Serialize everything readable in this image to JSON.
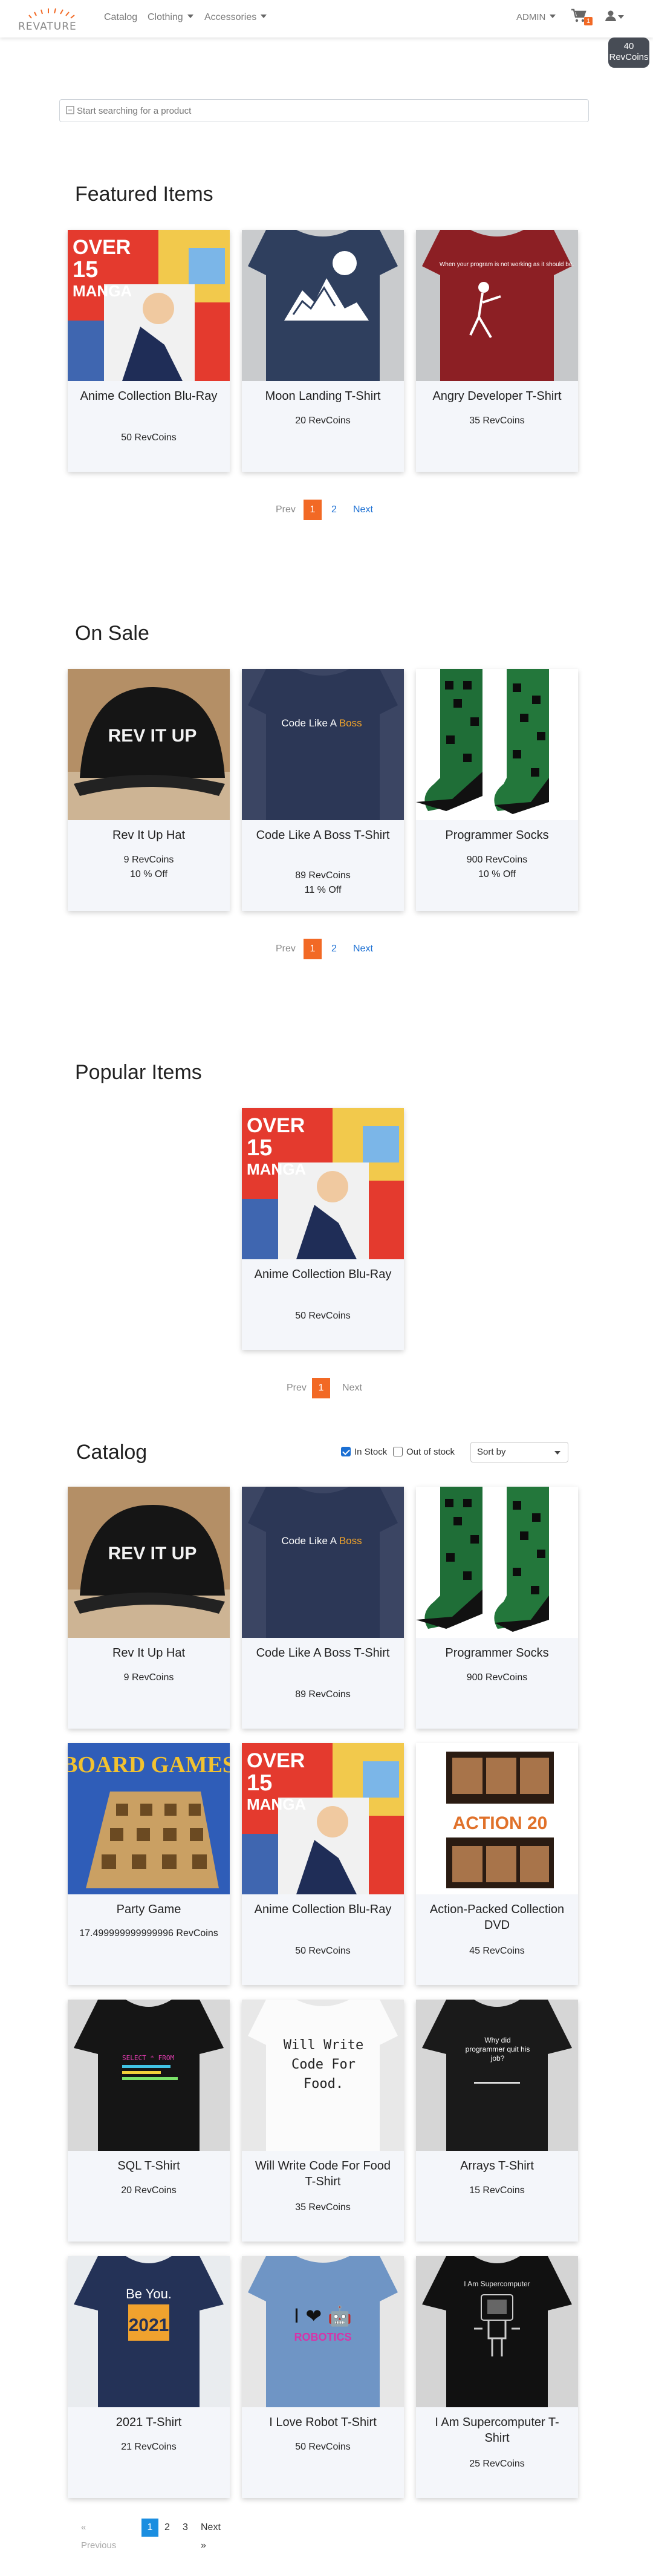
{
  "nav": {
    "logo_text": "REVATURE",
    "links": [
      {
        "label": "Catalog",
        "dropdown": false
      },
      {
        "label": "Clothing",
        "dropdown": true
      },
      {
        "label": "Accessories",
        "dropdown": true
      }
    ],
    "admin_label": "ADMIN",
    "cart_count": "1",
    "coins_amount": "40",
    "coins_label": "RevCoins"
  },
  "search": {
    "placeholder": "Start searching for a product"
  },
  "featured": {
    "title": "Featured Items",
    "items": [
      {
        "name": "Anime Collection Blu-Ray",
        "price": "50 RevCoins",
        "image": "anime-bluray"
      },
      {
        "name": "Moon Landing T-Shirt",
        "price": "20 RevCoins",
        "image": "moon-shirt"
      },
      {
        "name": "Angry Developer T-Shirt",
        "price": "35 RevCoins",
        "image": "angry-dev-shirt"
      }
    ],
    "pager": {
      "prev": "Prev",
      "pages": [
        "1",
        "2"
      ],
      "active": "1",
      "next": "Next"
    }
  },
  "on_sale": {
    "title": "On Sale",
    "items": [
      {
        "name": "Rev It Up Hat",
        "price": "9 RevCoins",
        "discount": "10 % Off",
        "image": "hat"
      },
      {
        "name": "Code Like A Boss T-Shirt",
        "price": "89 RevCoins",
        "discount": "11 % Off",
        "image": "boss-shirt"
      },
      {
        "name": "Programmer Socks",
        "price": "900 RevCoins",
        "discount": "10 % Off",
        "image": "socks"
      }
    ],
    "pager": {
      "prev": "Prev",
      "pages": [
        "1",
        "2"
      ],
      "active": "1",
      "next": "Next"
    }
  },
  "popular": {
    "title": "Popular Items",
    "items": [
      {
        "name": "Anime Collection Blu-Ray",
        "price": "50 RevCoins",
        "image": "anime-bluray"
      }
    ],
    "pager": {
      "prev": "Prev",
      "pages": [
        "1"
      ],
      "active": "1",
      "next": "Next"
    }
  },
  "catalog": {
    "title": "Catalog",
    "in_stock_label": "In Stock",
    "in_stock_checked": true,
    "out_of_stock_label": "Out of stock",
    "out_of_stock_checked": false,
    "sort_label": "Sort by",
    "items": [
      {
        "name": "Rev It Up Hat",
        "price": "9 RevCoins",
        "image": "hat"
      },
      {
        "name": "Code Like A Boss T-Shirt",
        "price": "89 RevCoins",
        "image": "boss-shirt"
      },
      {
        "name": "Programmer Socks",
        "price": "900 RevCoins",
        "image": "socks"
      },
      {
        "name": "Party Game",
        "price": "17.499999999999996 RevCoins",
        "image": "board-games"
      },
      {
        "name": "Anime Collection Blu-Ray",
        "price": "50 RevCoins",
        "image": "anime-bluray"
      },
      {
        "name": "Action-Packed Collection DVD",
        "price": "45 RevCoins",
        "image": "action-dvd"
      },
      {
        "name": "SQL T-Shirt",
        "price": "20 RevCoins",
        "image": "sql-shirt"
      },
      {
        "name": "Will Write Code For Food T-Shirt",
        "price": "35 RevCoins",
        "image": "food-shirt"
      },
      {
        "name": "Arrays T-Shirt",
        "price": "15 RevCoins",
        "image": "arrays-shirt"
      },
      {
        "name": "2021 T-Shirt",
        "price": "21 RevCoins",
        "image": "2021-shirt"
      },
      {
        "name": "I Love Robot T-Shirt",
        "price": "50 RevCoins",
        "image": "robot-shirt"
      },
      {
        "name": "I Am Supercomputer T-Shirt",
        "price": "25 RevCoins",
        "image": "supercomputer-shirt"
      }
    ],
    "pager": {
      "prev": "« Previous",
      "pages": [
        "1",
        "2",
        "3"
      ],
      "active": "1",
      "next": "Next »"
    }
  },
  "image_text": {
    "anime_line1": "OVER",
    "anime_line2": "15",
    "anime_line3": "MANGA",
    "dev_shirt_text": "When your program is not working as it should be.",
    "boss_text_a": "Code Like A ",
    "boss_text_b": "Boss",
    "hat_text": "REV IT UP",
    "board_games_text": "BOARD GAMES",
    "action_dvd_text": "ACTION 20",
    "food_shirt_text": "Will Write Code For Food.",
    "arrays_shirt_text": "Why did programmer quit his job?",
    "sql_shirt_text": "SELECT * FROM",
    "be_you_text": "Be You.",
    "year_text": "2021",
    "robot_text": "I ❤ 🤖",
    "robotics_text": "ROBOTICS",
    "supercomputer_text": "I Am Supercomputer"
  },
  "colors": {
    "accent": "#f26925",
    "link": "#1b6fd3",
    "card_bg": "#f4f6fa",
    "badge_bg": "#474c55"
  }
}
